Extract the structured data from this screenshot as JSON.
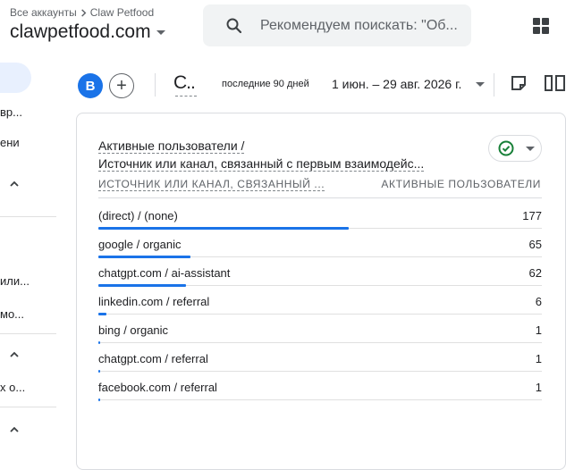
{
  "header": {
    "breadcrumb_root": "Все аккаунты",
    "breadcrumb_account": "Claw Petfood",
    "property": "clawpetfood.com",
    "search_placeholder": "Рекомендуем поискать: \"Об..."
  },
  "sidebar": {
    "items": [
      "вр...",
      "ени",
      "или...",
      "мо...",
      "х о..."
    ]
  },
  "toolbar": {
    "avatar_letter": "B",
    "add_label": "+",
    "comparison_label": "C..",
    "period_label": "последние 90 дней",
    "date_range": "1 июн. – 29 авг. 2026 г."
  },
  "card": {
    "title_metric": "Активные пользователи /",
    "title_dimension": "Источник или канал, связанный с первым взаимодейс...",
    "col_dimension": "ИСТОЧНИК ИЛИ КАНАЛ, СВЯЗАННЫЙ ...",
    "col_metric": "АКТИВНЫЕ ПОЛЬЗОВАТЕЛИ",
    "accent_color": "#1a73e8",
    "rows": [
      {
        "label": "(direct) / (none)",
        "value": 177
      },
      {
        "label": "google / organic",
        "value": 65
      },
      {
        "label": "chatgpt.com / ai-assistant",
        "value": 62
      },
      {
        "label": "linkedin.com / referral",
        "value": 6
      },
      {
        "label": "bing / organic",
        "value": 1
      },
      {
        "label": "chatgpt.com / referral",
        "value": 1
      },
      {
        "label": "facebook.com / referral",
        "value": 1
      }
    ]
  }
}
